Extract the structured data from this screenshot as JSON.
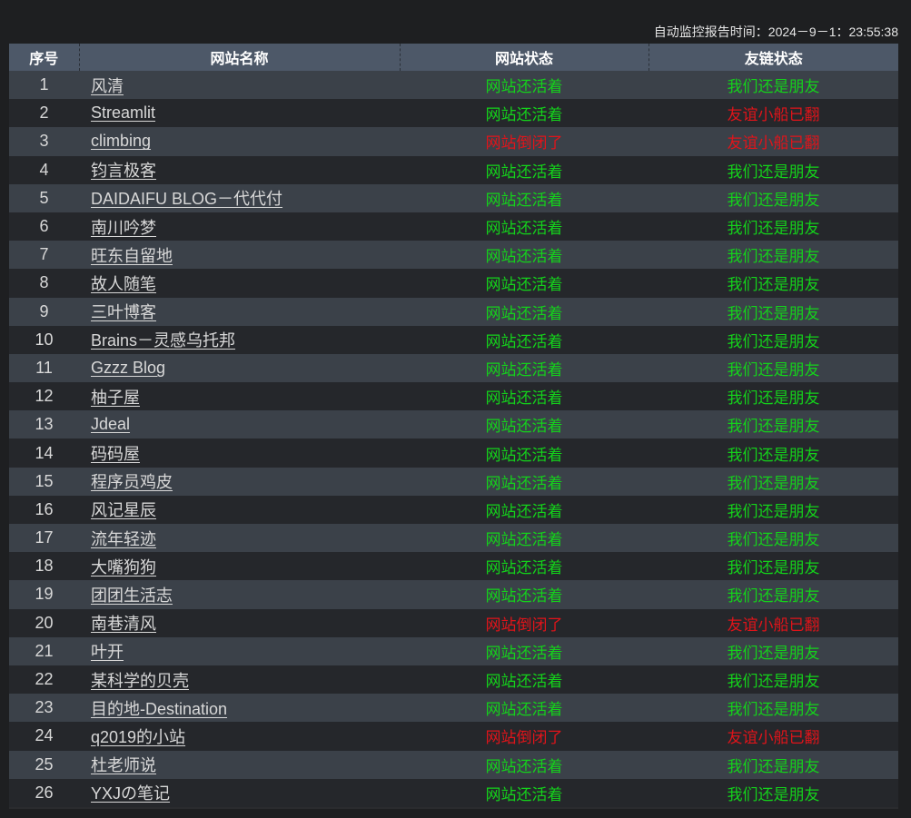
{
  "report_time": "自动监控报告时间：2024－9－1：23:55:38",
  "colors": {
    "ok": "#14d21b",
    "bad": "#e0141a",
    "header_bg": "#4d5868"
  },
  "table": {
    "headers": [
      "序号",
      "网站名称",
      "网站状态",
      "友链状态"
    ],
    "rows": [
      {
        "index": "1",
        "name": "风清",
        "site_status": "网站还活着",
        "site_ok": true,
        "link_status": "我们还是朋友",
        "link_ok": true
      },
      {
        "index": "2",
        "name": "Streamlit",
        "site_status": "网站还活着",
        "site_ok": true,
        "link_status": "友谊小船已翻",
        "link_ok": false
      },
      {
        "index": "3",
        "name": "climbing",
        "site_status": "网站倒闭了",
        "site_ok": false,
        "link_status": "友谊小船已翻",
        "link_ok": false
      },
      {
        "index": "4",
        "name": "钧言极客",
        "site_status": "网站还活着",
        "site_ok": true,
        "link_status": "我们还是朋友",
        "link_ok": true
      },
      {
        "index": "5",
        "name": "DAIDAIFU BLOG－代代付",
        "site_status": "网站还活着",
        "site_ok": true,
        "link_status": "我们还是朋友",
        "link_ok": true
      },
      {
        "index": "6",
        "name": "南川吟梦",
        "site_status": "网站还活着",
        "site_ok": true,
        "link_status": "我们还是朋友",
        "link_ok": true
      },
      {
        "index": "7",
        "name": "旺东自留地",
        "site_status": "网站还活着",
        "site_ok": true,
        "link_status": "我们还是朋友",
        "link_ok": true
      },
      {
        "index": "8",
        "name": "故人随笔",
        "site_status": "网站还活着",
        "site_ok": true,
        "link_status": "我们还是朋友",
        "link_ok": true
      },
      {
        "index": "9",
        "name": "三叶博客",
        "site_status": "网站还活着",
        "site_ok": true,
        "link_status": "我们还是朋友",
        "link_ok": true
      },
      {
        "index": "10",
        "name": "Brains－灵感乌托邦",
        "site_status": "网站还活着",
        "site_ok": true,
        "link_status": "我们还是朋友",
        "link_ok": true
      },
      {
        "index": "11",
        "name": "Gzzz Blog",
        "site_status": "网站还活着",
        "site_ok": true,
        "link_status": "我们还是朋友",
        "link_ok": true
      },
      {
        "index": "12",
        "name": "柚子屋",
        "site_status": "网站还活着",
        "site_ok": true,
        "link_status": "我们还是朋友",
        "link_ok": true
      },
      {
        "index": "13",
        "name": "Jdeal",
        "site_status": "网站还活着",
        "site_ok": true,
        "link_status": "我们还是朋友",
        "link_ok": true
      },
      {
        "index": "14",
        "name": "码码屋",
        "site_status": "网站还活着",
        "site_ok": true,
        "link_status": "我们还是朋友",
        "link_ok": true
      },
      {
        "index": "15",
        "name": "程序员鸡皮",
        "site_status": "网站还活着",
        "site_ok": true,
        "link_status": "我们还是朋友",
        "link_ok": true
      },
      {
        "index": "16",
        "name": "风记星辰",
        "site_status": "网站还活着",
        "site_ok": true,
        "link_status": "我们还是朋友",
        "link_ok": true
      },
      {
        "index": "17",
        "name": "流年轻迹",
        "site_status": "网站还活着",
        "site_ok": true,
        "link_status": "我们还是朋友",
        "link_ok": true
      },
      {
        "index": "18",
        "name": "大嘴狗狗",
        "site_status": "网站还活着",
        "site_ok": true,
        "link_status": "我们还是朋友",
        "link_ok": true
      },
      {
        "index": "19",
        "name": "团团生活志",
        "site_status": "网站还活着",
        "site_ok": true,
        "link_status": "我们还是朋友",
        "link_ok": true
      },
      {
        "index": "20",
        "name": "南巷清风",
        "site_status": "网站倒闭了",
        "site_ok": false,
        "link_status": "友谊小船已翻",
        "link_ok": false
      },
      {
        "index": "21",
        "name": "叶开",
        "site_status": "网站还活着",
        "site_ok": true,
        "link_status": "我们还是朋友",
        "link_ok": true
      },
      {
        "index": "22",
        "name": "某科学的贝壳",
        "site_status": "网站还活着",
        "site_ok": true,
        "link_status": "我们还是朋友",
        "link_ok": true
      },
      {
        "index": "23",
        "name": "目的地-Destination",
        "site_status": "网站还活着",
        "site_ok": true,
        "link_status": "我们还是朋友",
        "link_ok": true
      },
      {
        "index": "24",
        "name": "q2019的小站",
        "site_status": "网站倒闭了",
        "site_ok": false,
        "link_status": "友谊小船已翻",
        "link_ok": false
      },
      {
        "index": "25",
        "name": "杜老师说",
        "site_status": "网站还活着",
        "site_ok": true,
        "link_status": "我们还是朋友",
        "link_ok": true
      },
      {
        "index": "26",
        "name": "YXJの笔记",
        "site_status": "网站还活着",
        "site_ok": true,
        "link_status": "我们还是朋友",
        "link_ok": true
      }
    ]
  }
}
